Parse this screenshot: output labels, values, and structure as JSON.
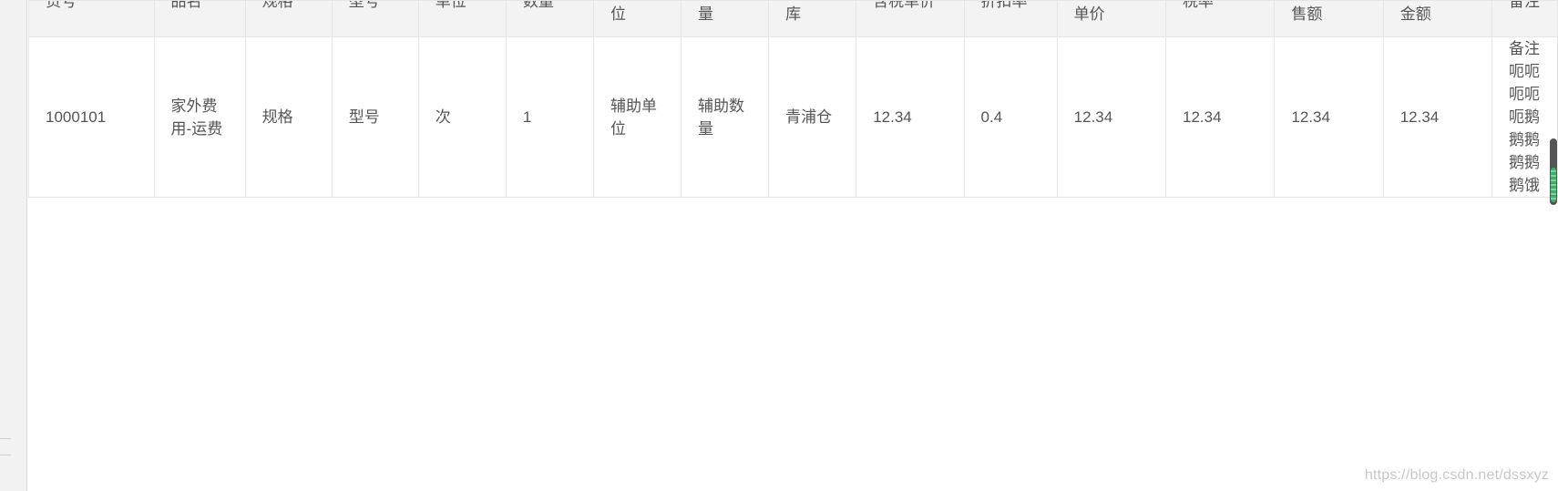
{
  "table": {
    "headers": [
      {
        "l1": "货号",
        "l2": ""
      },
      {
        "l1": "品名",
        "l2": ""
      },
      {
        "l1": "规格",
        "l2": ""
      },
      {
        "l1": "型号",
        "l2": ""
      },
      {
        "l1": "单位",
        "l2": ""
      },
      {
        "l1": "数量",
        "l2": ""
      },
      {
        "l1": "",
        "l2": "位"
      },
      {
        "l1": "",
        "l2": "量"
      },
      {
        "l1": "",
        "l2": "库"
      },
      {
        "l1": "含税单价",
        "l2": ""
      },
      {
        "l1": "折扣率",
        "l2": ""
      },
      {
        "l1": "",
        "l2": "单价"
      },
      {
        "l1": "税率",
        "l2": ""
      },
      {
        "l1": "",
        "l2": "售额"
      },
      {
        "l1": "",
        "l2": "金额"
      },
      {
        "l1": "备注",
        "l2": ""
      }
    ],
    "rows": [
      {
        "cells": [
          "1000101",
          "家外费用-运费",
          "规格",
          "型号",
          "次",
          "1",
          "辅助单位",
          "辅助数量",
          "青浦仓",
          "12.34",
          "0.4",
          "12.34",
          "12.34",
          "12.34",
          "12.34",
          "备注呃呃呃呃呃鹅鹅鹅鹅鹅鹅饿"
        ]
      }
    ]
  },
  "watermark": "https://blog.csdn.net/dssxyz",
  "colors": {
    "header_bg": "#f3f3f3",
    "border": "#e6e6e6",
    "scrollbar_thumb": "#555555",
    "scrollbar_fill": "#33b36a"
  }
}
